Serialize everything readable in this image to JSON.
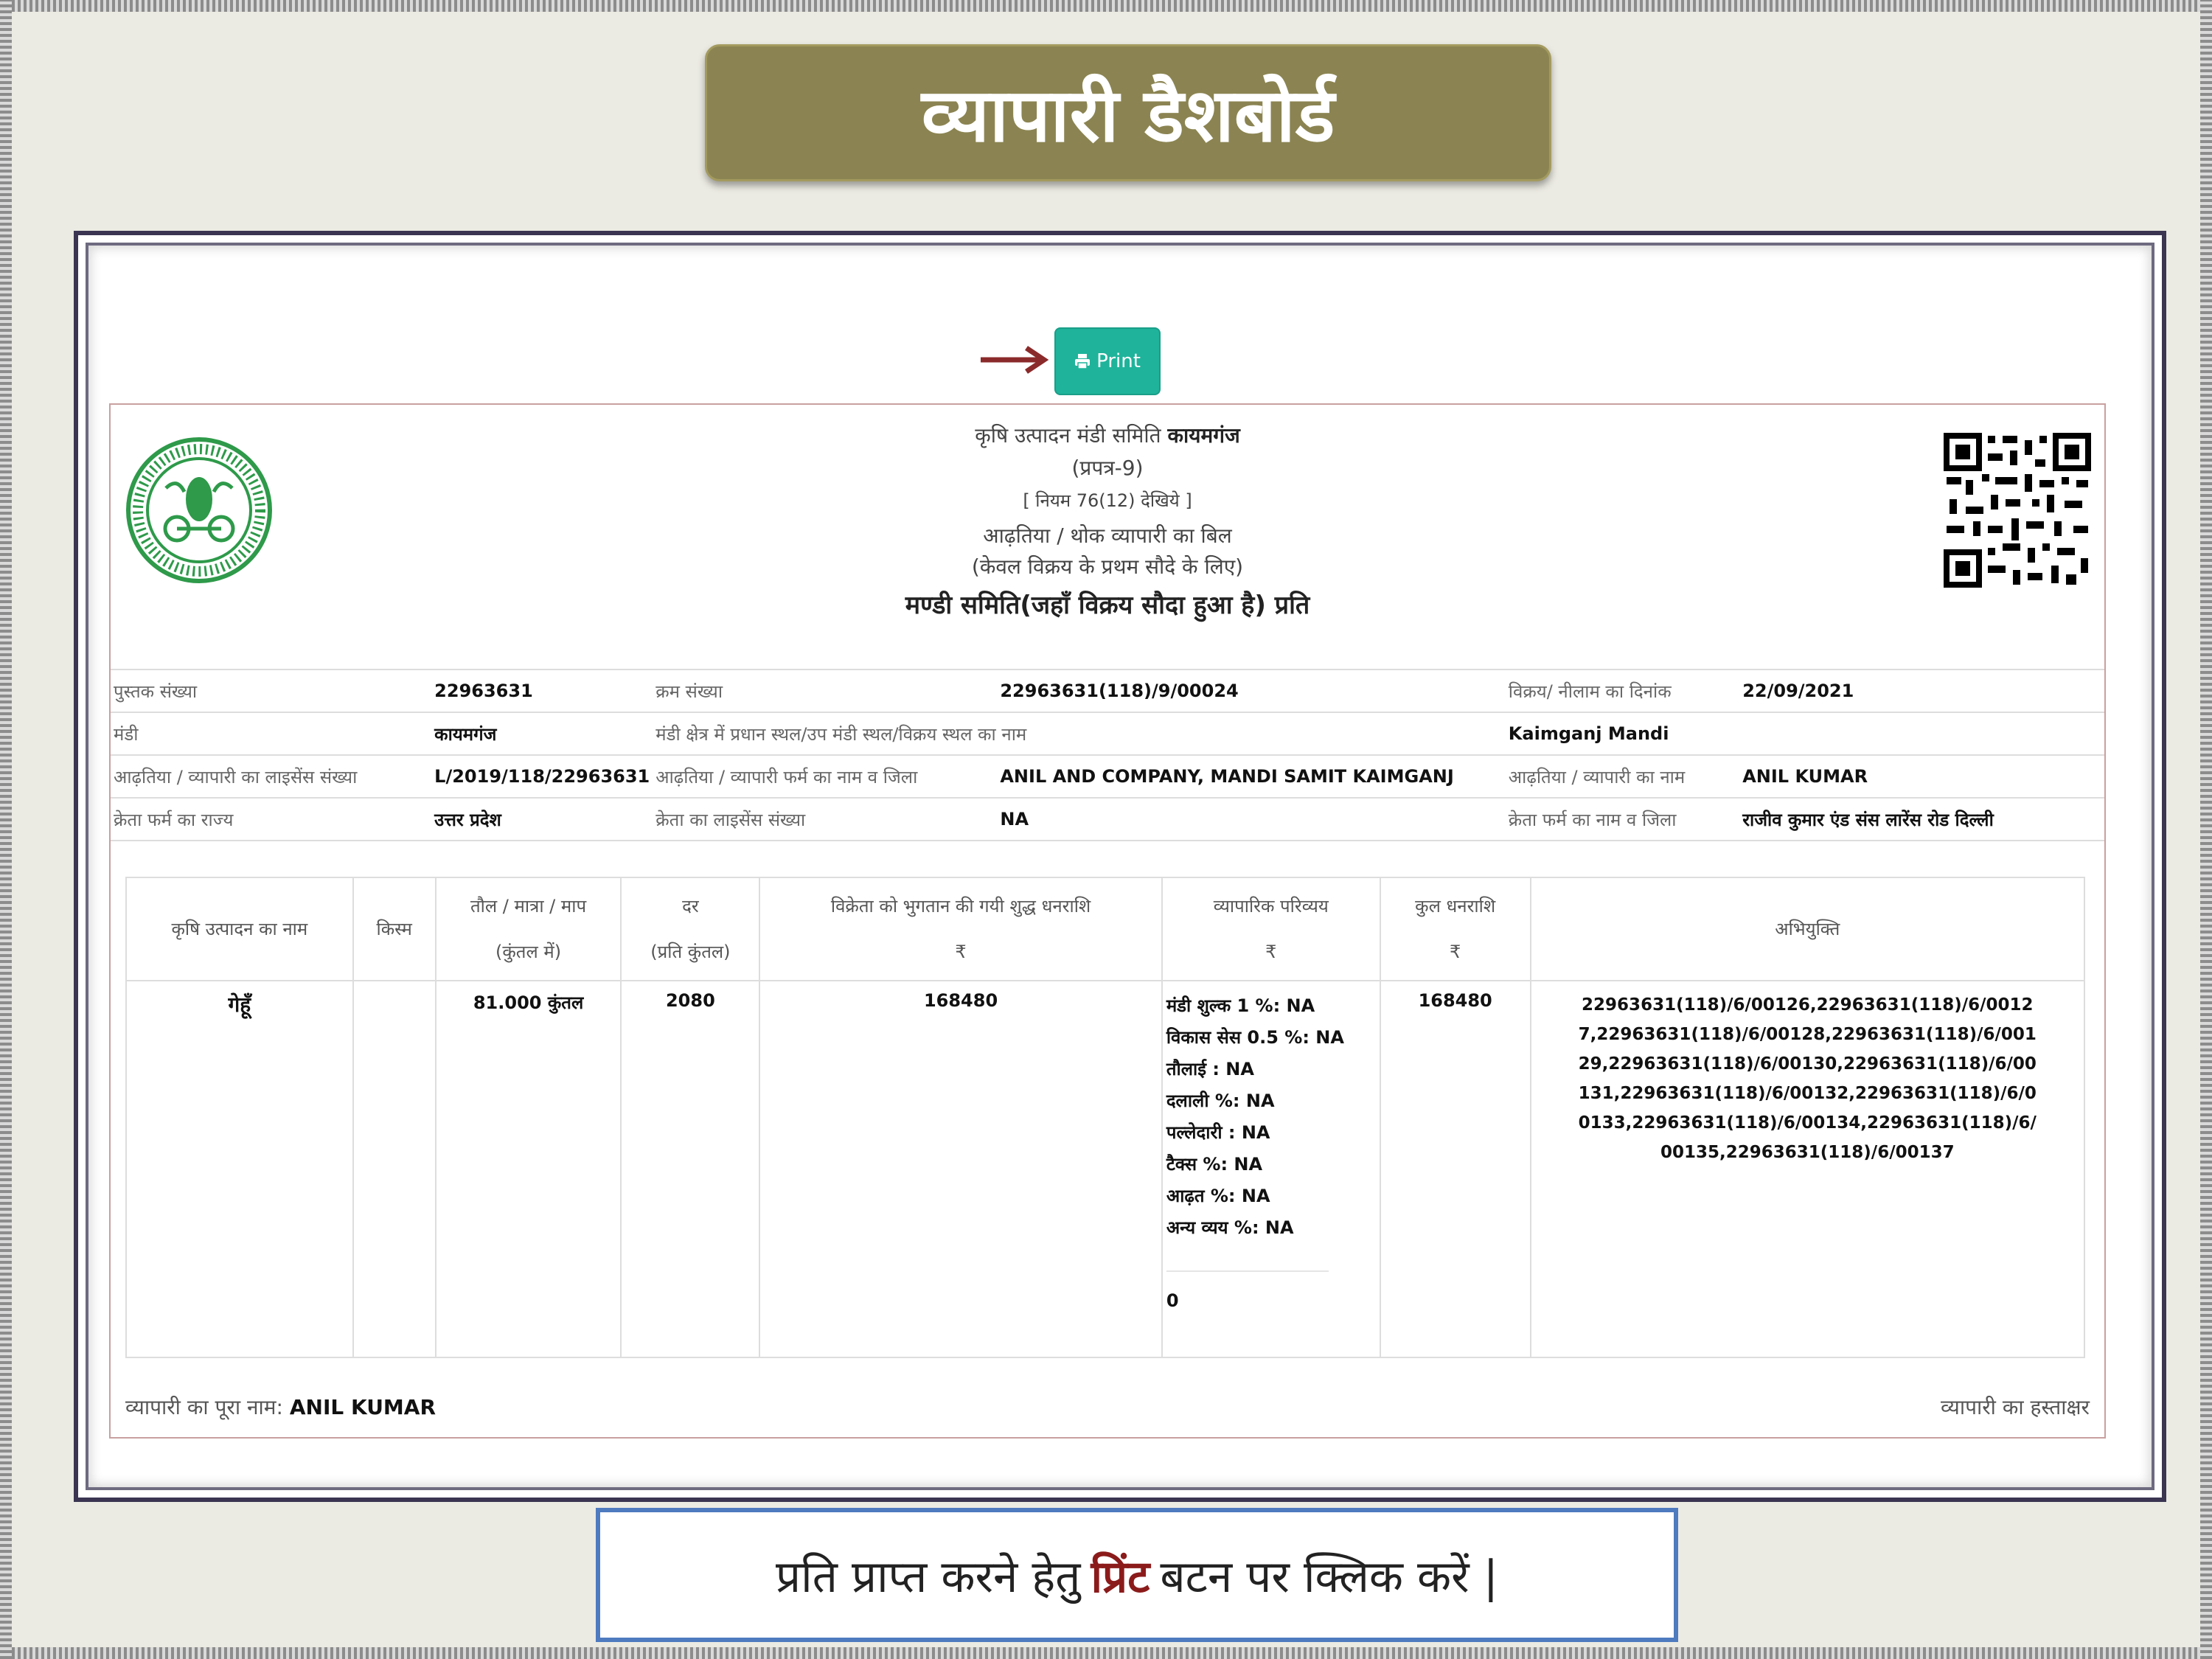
{
  "title": "व्यापारी डैशबोर्ड",
  "print_button": {
    "label": "Print"
  },
  "document": {
    "header": {
      "committee_prefix": "कृषि उत्पादन मंडी समिति",
      "committee_name": "कायमगंज",
      "form": "(प्रपत्र-9)",
      "rule": "[ नियम 76(12) देखिये ]",
      "bill_title": "आढ़तिया / थोक व्यापारी का बिल",
      "bill_subtitle": "(केवल विक्रय के प्रथम सौदे के लिए)",
      "copy_for": "मण्डी समिति(जहाँ विक्रय सौदा हुआ है) प्रति"
    },
    "info": [
      [
        "पुस्तक संख्या",
        "22963631",
        "क्रम संख्या",
        "22963631(118)/9/00024",
        "विक्रय/ नीलाम का दिनांक",
        "22/09/2021"
      ],
      [
        "मंडी",
        "कायमगंज",
        "मंडी क्षेत्र में प्रधान स्थल/उप मंडी स्थल/विक्रय स्थल का नाम",
        "",
        "Kaimganj Mandi",
        ""
      ],
      [
        "आढ़तिया / व्यापारी का लाइसेंस संख्या",
        "L/2019/118/22963631",
        "आढ़तिया / व्यापारी फर्म का नाम व जिला",
        "ANIL AND COMPANY, MANDI SAMIT KAIMGANJ",
        "आढ़तिया / व्यापारी का नाम",
        "ANIL KUMAR"
      ],
      [
        "क्रेता फर्म का राज्य",
        "उत्तर प्रदेश",
        "क्रेता का लाइसेंस संख्या",
        "NA",
        "क्रेता फर्म का नाम व जिला",
        "राजीव कुमार एंड संस लारेंस रोड दिल्ली"
      ]
    ],
    "goods_headers": {
      "product": "कृषि उत्पादन का नाम",
      "variety": "किस्म",
      "qty_1": "तौल / मात्रा / माप",
      "qty_2": "(कुंतल में)",
      "rate_1": "दर",
      "rate_2": "(प्रति कुंतल)",
      "net_1": "विक्रेता को भुगतान की गयी शुद्ध धनराशि",
      "net_2": "₹",
      "exp_1": "व्यापारिक परिव्यय",
      "exp_2": "₹",
      "total_1": "कुल धनराशि",
      "total_2": "₹",
      "remarks": "अभियुक्ति"
    },
    "goods_row": {
      "product": "गेहूँ",
      "variety": "",
      "qty": "81.000 कुंतल",
      "rate": "2080",
      "net": "168480",
      "expenses": [
        "मंडी शुल्क 1 %: NA",
        "विकास सेस 0.5 %: NA",
        "तौलाई : NA",
        "दलाली %: NA",
        "पल्लेदारी : NA",
        "टैक्स %: NA",
        "आढ़त %: NA",
        "अन्य व्यय %: NA"
      ],
      "expense_total": "0",
      "total": "168480",
      "remarks": "22963631(118)/6/00126,22963631(118)/6/00127,22963631(118)/6/00128,22963631(118)/6/00129,22963631(118)/6/00130,22963631(118)/6/00131,22963631(118)/6/00132,22963631(118)/6/00133,22963631(118)/6/00134,22963631(118)/6/00135,22963631(118)/6/00137"
    },
    "trader_name_label": "व्यापारी का पूरा नाम:",
    "trader_name": "ANIL KUMAR",
    "trader_signature": "व्यापारी का हस्ताक्षर"
  },
  "instruction": {
    "before": "प्रति प्राप्त करने हेतु",
    "highlight": "प्रिंट",
    "after": "बटन पर क्लिक करें |"
  },
  "colors": {
    "banner": "#8b8452",
    "print_button": "#1fb39b",
    "arrow": "#8b2a2a",
    "instruction_border": "#4e7abf",
    "highlight": "#8b1b1b"
  }
}
